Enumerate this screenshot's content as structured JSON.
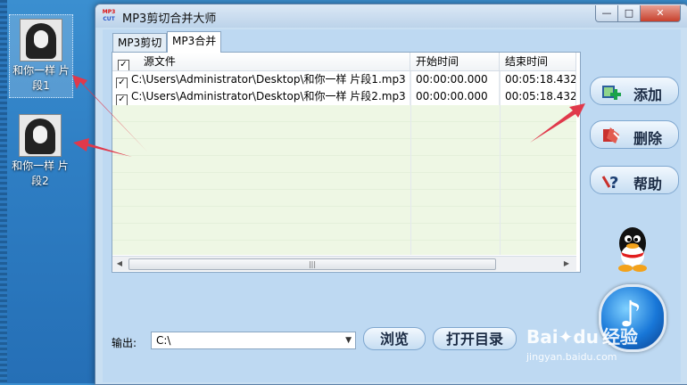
{
  "desktop": {
    "icons": [
      {
        "label_line1": "和你一样 片",
        "label_line2": "段1"
      },
      {
        "label_line1": "和你一样 片",
        "label_line2": "段2"
      }
    ]
  },
  "window": {
    "logo_text_top": "MP3",
    "logo_text_bottom": "CUT",
    "title": "MP3剪切合并大师",
    "controls": {
      "minimize": "—",
      "maximize": "□",
      "close": "✕"
    }
  },
  "tabs": [
    {
      "label": "MP3剪切",
      "active": false
    },
    {
      "label": "MP3合并",
      "active": true
    }
  ],
  "list": {
    "columns": [
      "源文件",
      "开始时间",
      "结束时间"
    ],
    "rows": [
      {
        "checked": true,
        "file": "C:\\Users\\Administrator\\Desktop\\和你一样 片段1.mp3",
        "start": "00:00:00.000",
        "end": "00:05:18.432"
      },
      {
        "checked": true,
        "file": "C:\\Users\\Administrator\\Desktop\\和你一样 片段2.mp3",
        "start": "00:00:00.000",
        "end": "00:05:18.432"
      }
    ],
    "scroll_grip": "|||"
  },
  "side_buttons": {
    "add": "添加",
    "delete": "删除",
    "help": "帮助"
  },
  "output": {
    "label": "输出:",
    "path": "C:\\",
    "browse": "浏览",
    "open_dir": "打开目录"
  },
  "watermark": {
    "brand": "Bai",
    "brand2": "经验",
    "url": "jingyan.baidu.com"
  },
  "colors": {
    "accent_arrow": "#e0394b",
    "desktop_blue": "#2f7fc4"
  }
}
